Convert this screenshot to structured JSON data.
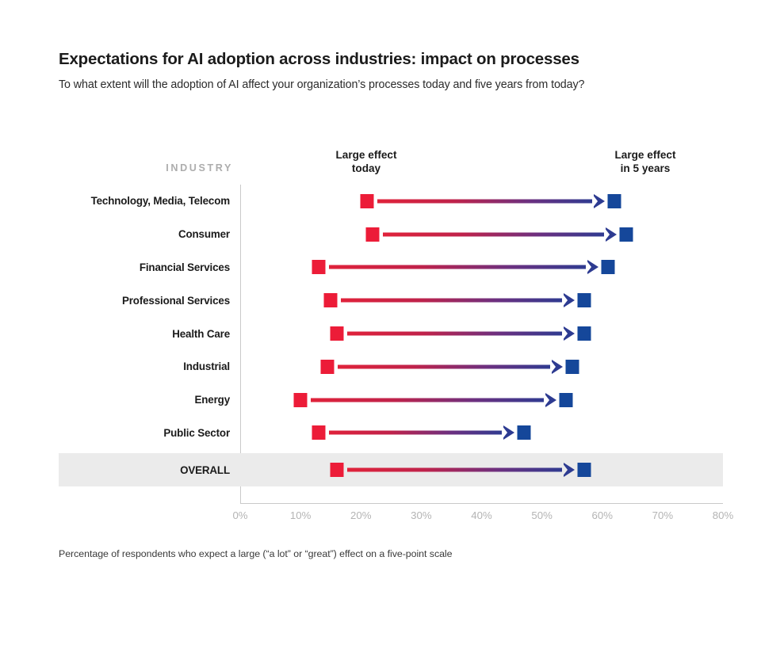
{
  "header": {
    "title": "Expectations for AI adoption across industries: impact on processes",
    "subtitle": "To what extent will the adoption of AI affect your organization’s processes today and five years from today?"
  },
  "labels": {
    "industry_header": "INDUSTRY",
    "col_today": "Large effect\ntoday",
    "col_future": "Large effect\nin 5 years"
  },
  "footnote": "Percentage of respondents who expect a large (“a lot” or “great”) effect on a five-point scale",
  "colors": {
    "today": "#ec1c38",
    "future": "#15479a",
    "highlight_band": "#ebebeb",
    "axis_text": "#b4b4b4",
    "industry_header": "#adadad"
  },
  "chart_data": {
    "type": "bar",
    "title": "Expectations for AI adoption across industries: impact on processes",
    "subtitle": "To what extent will the adoption of AI affect your organization’s processes today and five years from today?",
    "xlabel": "",
    "ylabel": "INDUSTRY",
    "xlim": [
      0,
      80
    ],
    "grid": false,
    "legend_position": "top",
    "tick_labels": [
      "0%",
      "10%",
      "20%",
      "30%",
      "40%",
      "50%",
      "60%",
      "70%",
      "80%"
    ],
    "ticks": [
      0,
      10,
      20,
      30,
      40,
      50,
      60,
      70,
      80
    ],
    "categories": [
      "Technology, Media, Telecom",
      "Consumer",
      "Financial Services",
      "Professional Services",
      "Health Care",
      "Industrial",
      "Energy",
      "Public Sector",
      "OVERALL"
    ],
    "series": [
      {
        "name": "Large effect today",
        "values": [
          21,
          22,
          13,
          15,
          16,
          14.5,
          10,
          13,
          16
        ]
      },
      {
        "name": "Large effect in 5 years",
        "values": [
          62,
          64,
          61,
          57,
          57,
          55,
          54,
          47,
          57
        ]
      }
    ],
    "highlight_category": "OVERALL"
  }
}
